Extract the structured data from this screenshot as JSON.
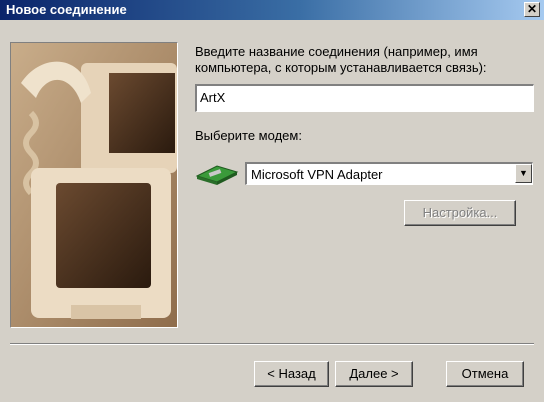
{
  "window": {
    "title": "Новое соединение",
    "close_label": "×"
  },
  "form": {
    "name_prompt_line1": "Введите название соединения (например, имя",
    "name_prompt_line2": "компьютера, с которым устанавливается связь):",
    "name_value": "ArtX",
    "modem_label": "Выберите модем:",
    "modem_selected": "Microsoft VPN Adapter",
    "configure_button": "Настройка..."
  },
  "buttons": {
    "back": "< Назад",
    "next": "Далее >",
    "cancel": "Отмена"
  },
  "icons": {
    "illustration": "computer-monitors-illustration",
    "modem": "modem-icon",
    "dropdown": "chevron-down-icon"
  }
}
